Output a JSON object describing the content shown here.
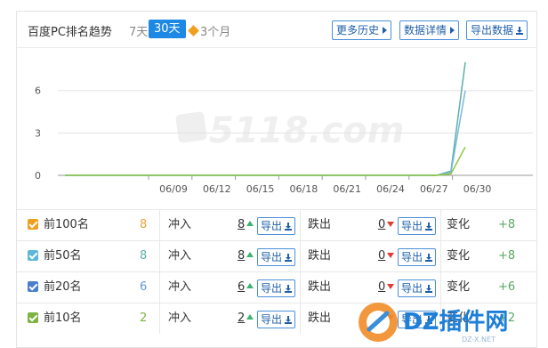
{
  "header": {
    "title": "百度PC排名趋势",
    "periods": [
      "7天",
      "30天",
      "3个月"
    ],
    "active_period": "30天",
    "buttons": {
      "history": "更多历史",
      "details": "数据详情",
      "export": "导出数据"
    }
  },
  "watermark": "5118.com",
  "chart_data": {
    "type": "line",
    "x_ticks": [
      "06/09",
      "06/12",
      "06/15",
      "06/18",
      "06/21",
      "06/24",
      "06/27",
      "06/30"
    ],
    "y_ticks": [
      0,
      3,
      6
    ],
    "ylim": [
      0,
      8.5
    ],
    "series": [
      {
        "name": "前100名",
        "color": "#5bb0a8",
        "values": [
          0,
          0,
          0,
          0,
          0,
          0,
          0,
          0,
          0,
          0,
          0,
          0,
          0,
          0,
          0,
          0,
          0,
          0,
          0,
          0,
          0,
          0,
          0,
          0,
          0,
          0,
          0,
          0.3,
          8
        ]
      },
      {
        "name": "前50名",
        "color": "#7ab8e0",
        "values": [
          0,
          0,
          0,
          0,
          0,
          0,
          0,
          0,
          0,
          0,
          0,
          0,
          0,
          0,
          0,
          0,
          0,
          0,
          0,
          0,
          0,
          0,
          0,
          0,
          0,
          0,
          0,
          0.2,
          6
        ]
      },
      {
        "name": "前10名",
        "color": "#8cc63f",
        "values": [
          0,
          0,
          0,
          0,
          0,
          0,
          0,
          0,
          0,
          0,
          0,
          0,
          0,
          0,
          0,
          0,
          0,
          0,
          0,
          0,
          0,
          0,
          0,
          0,
          0,
          0,
          0,
          0.1,
          2
        ]
      }
    ]
  },
  "rows": [
    {
      "label": "前100名",
      "count": "8",
      "count_color": "#e8a33c",
      "check_color": "#f0a020",
      "in_label": "冲入",
      "in": "8",
      "out_label": "跌出",
      "out": "0",
      "change_label": "变化",
      "change": "+8",
      "export": "导出"
    },
    {
      "label": "前50名",
      "count": "8",
      "count_color": "#5bb0a8",
      "check_color": "#5bb8d8",
      "in_label": "冲入",
      "in": "8",
      "out_label": "跌出",
      "out": "0",
      "change_label": "变化",
      "change": "+8",
      "export": "导出"
    },
    {
      "label": "前20名",
      "count": "6",
      "count_color": "#5b9bd5",
      "check_color": "#4a7fd0",
      "in_label": "冲入",
      "in": "6",
      "out_label": "跌出",
      "out": "0",
      "change_label": "变化",
      "change": "+6",
      "export": "导出"
    },
    {
      "label": "前10名",
      "count": "2",
      "count_color": "#7cb342",
      "check_color": "#7cb342",
      "in_label": "冲入",
      "in": "2",
      "out_label": "跌出",
      "out": "0",
      "change_label": "变化",
      "change": "+2",
      "export": "导出"
    }
  ],
  "overlay_logo": {
    "text": "DZ插件网",
    "sub": "DZ-X.NET"
  }
}
